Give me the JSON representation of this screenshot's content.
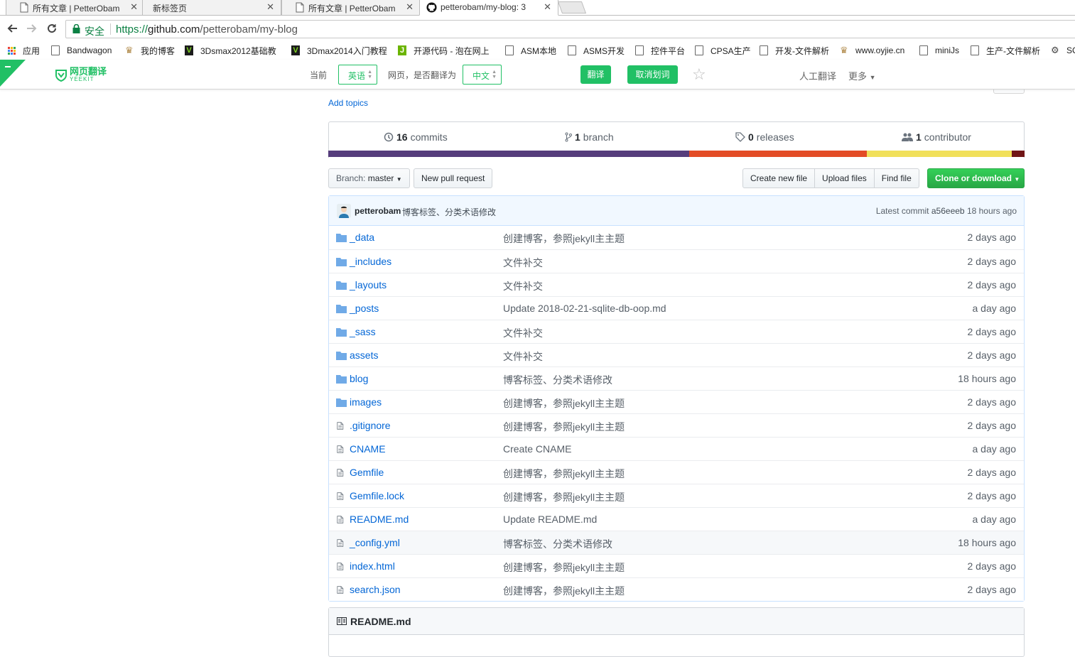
{
  "browser": {
    "tabs": [
      {
        "title": "所有文章 | PetterObam",
        "active": false
      },
      {
        "title": "新标签页",
        "active": false
      },
      {
        "title": "所有文章 | PetterObam",
        "active": false
      },
      {
        "title": "petterobam/my-blog: 3",
        "active": true
      }
    ],
    "close_glyph": "✕",
    "address": {
      "secure_label": "安全",
      "url_scheme": "https://",
      "url_host": "github.com",
      "url_path": "/petterobam/my-blog"
    },
    "bookmarks": [
      {
        "label": "应用",
        "icon": "apps-grid-icon"
      },
      {
        "label": "Bandwagon",
        "icon": "page-icon"
      },
      {
        "label": "我的博客",
        "icon": "trophy-icon"
      },
      {
        "label": "3Dsmax2012基础教",
        "icon": "v-icon"
      },
      {
        "label": "3Dmax2014入门教程",
        "icon": "v-icon"
      },
      {
        "label": "开源代码 - 泡在网上",
        "icon": "j-icon"
      },
      {
        "label": "ASM本地",
        "icon": "page-icon"
      },
      {
        "label": "ASMS开发",
        "icon": "page-icon"
      },
      {
        "label": "控件平台",
        "icon": "page-icon"
      },
      {
        "label": "CPSA生产",
        "icon": "page-icon"
      },
      {
        "label": "开发-文件解析",
        "icon": "page-icon"
      },
      {
        "label": "www.oyjie.cn",
        "icon": "trophy-icon"
      },
      {
        "label": "miniJs",
        "icon": "page-icon"
      },
      {
        "label": "生产-文件解析",
        "icon": "page-icon"
      },
      {
        "label": "SC",
        "icon": "gear-icon"
      }
    ]
  },
  "translate_bar": {
    "brand": "网页翻译",
    "brand_sub": "YEEKIT",
    "current_label": "当前",
    "source_lang": "英语",
    "middle_label": "网页，是否翻译为",
    "target_lang": "中文",
    "translate_button": "翻译",
    "cancel_button": "取消划词",
    "human_translate": "人工翻译",
    "more": "更多",
    "accent_color": "#21c065"
  },
  "repo": {
    "add_topics": "Add topics",
    "summary": {
      "commits_count": "16",
      "commits_label": "commits",
      "branch_count": "1",
      "branch_label": "branch",
      "releases_count": "0",
      "releases_label": "releases",
      "contributor_count": "1",
      "contributor_label": "contributor"
    },
    "language_bar": [
      {
        "share": 0.518,
        "color": "#563d7c"
      },
      {
        "share": 0.255,
        "color": "#e34c26"
      },
      {
        "share": 0.209,
        "color": "#f1e05a"
      },
      {
        "share": 0.018,
        "color": "#701516"
      }
    ],
    "branch_label": "Branch:",
    "branch_name": "master",
    "new_pull_request": "New pull request",
    "create_new_file": "Create new file",
    "upload_files": "Upload files",
    "find_file": "Find file",
    "clone_or_download": "Clone or download",
    "latest_commit": {
      "author": "petterobam",
      "message": "博客标签、分类术语修改",
      "latest_label": "Latest commit",
      "sha": "a56eeeb",
      "age": "18 hours ago"
    },
    "files": [
      {
        "name": "_data",
        "type": "dir",
        "message": "创建博客，参照jekyll主主题",
        "age": "2 days ago"
      },
      {
        "name": "_includes",
        "type": "dir",
        "message": "文件补交",
        "age": "2 days ago"
      },
      {
        "name": "_layouts",
        "type": "dir",
        "message": "文件补交",
        "age": "2 days ago"
      },
      {
        "name": "_posts",
        "type": "dir",
        "message": "Update 2018-02-21-sqlite-db-oop.md",
        "age": "a day ago"
      },
      {
        "name": "_sass",
        "type": "dir",
        "message": "文件补交",
        "age": "2 days ago"
      },
      {
        "name": "assets",
        "type": "dir",
        "message": "文件补交",
        "age": "2 days ago"
      },
      {
        "name": "blog",
        "type": "dir",
        "message": "博客标签、分类术语修改",
        "age": "18 hours ago"
      },
      {
        "name": "images",
        "type": "dir",
        "message": "创建博客，参照jekyll主主题",
        "age": "2 days ago"
      },
      {
        "name": ".gitignore",
        "type": "file",
        "message": "创建博客，参照jekyll主主题",
        "age": "2 days ago"
      },
      {
        "name": "CNAME",
        "type": "file",
        "message": "Create CNAME",
        "age": "a day ago"
      },
      {
        "name": "Gemfile",
        "type": "file",
        "message": "创建博客，参照jekyll主主题",
        "age": "2 days ago"
      },
      {
        "name": "Gemfile.lock",
        "type": "file",
        "message": "创建博客，参照jekyll主主题",
        "age": "2 days ago"
      },
      {
        "name": "README.md",
        "type": "file",
        "message": "Update README.md",
        "age": "a day ago"
      },
      {
        "name": "_config.yml",
        "type": "file",
        "message": "博客标签、分类术语修改",
        "age": "18 hours ago"
      },
      {
        "name": "index.html",
        "type": "file",
        "message": "创建博客，参照jekyll主主题",
        "age": "2 days ago"
      },
      {
        "name": "search.json",
        "type": "file",
        "message": "创建博客，参照jekyll主主题",
        "age": "2 days ago"
      }
    ],
    "readme_title": "README.md"
  }
}
